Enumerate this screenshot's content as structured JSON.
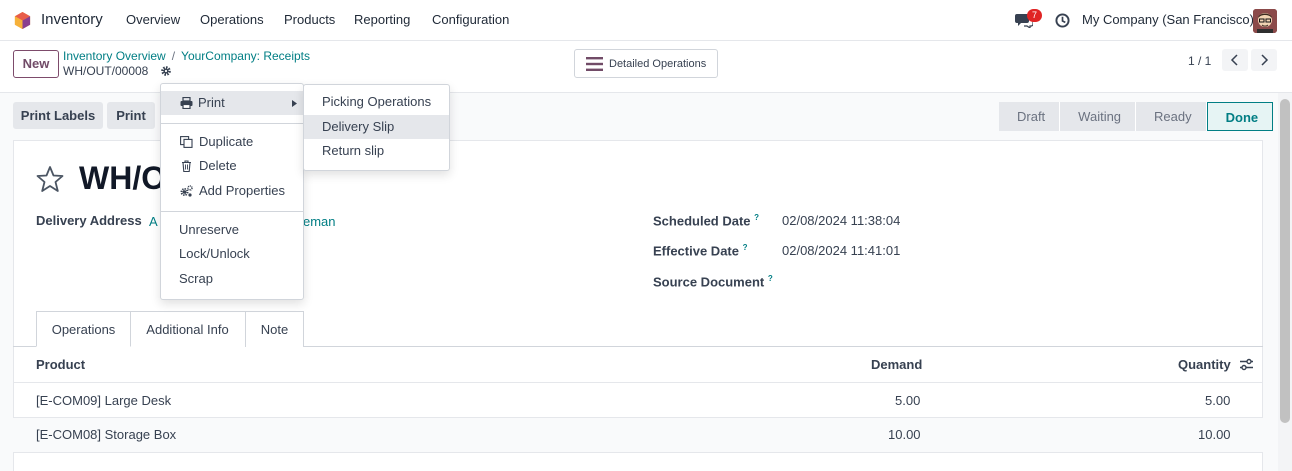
{
  "navbar": {
    "app_name": "Inventory",
    "menu": [
      "Overview",
      "Operations",
      "Products",
      "Reporting",
      "Configuration"
    ],
    "chat_badge": "7",
    "company": "My Company (San Francisco)"
  },
  "control_panel": {
    "new_label": "New",
    "breadcrumb": [
      "Inventory Overview",
      "YourCompany: Receipts"
    ],
    "record_name": "WH/OUT/00008",
    "detailed_ops_label": "Detailed Operations",
    "pager": "1 / 1"
  },
  "actions": {
    "print_labels": "Print Labels",
    "print": "Print"
  },
  "status_steps": [
    "Draft",
    "Waiting",
    "Ready",
    "Done"
  ],
  "status_active": "Done",
  "form": {
    "title": "WH/O",
    "delivery_address_label": "Delivery Address",
    "delivery_address_value_left": "A",
    "delivery_address_value_right": "eman",
    "scheduled_date_label": "Scheduled Date",
    "scheduled_date": "02/08/2024 11:38:04",
    "effective_date_label": "Effective Date",
    "effective_date": "02/08/2024 11:41:01",
    "source_document_label": "Source Document",
    "help_mark": "?"
  },
  "tabs": [
    "Operations",
    "Additional Info",
    "Note"
  ],
  "table": {
    "headers": {
      "product": "Product",
      "demand": "Demand",
      "quantity": "Quantity"
    },
    "rows": [
      {
        "product": "[E-COM09] Large Desk",
        "demand": "5.00",
        "quantity": "5.00"
      },
      {
        "product": "[E-COM08] Storage Box",
        "demand": "10.00",
        "quantity": "10.00"
      }
    ]
  },
  "dropdown": {
    "print": "Print",
    "duplicate": "Duplicate",
    "delete": "Delete",
    "add_properties": "Add Properties",
    "unreserve": "Unreserve",
    "lock_unlock": "Lock/Unlock",
    "scrap": "Scrap"
  },
  "submenu": [
    "Picking Operations",
    "Delivery Slip",
    "Return slip"
  ],
  "colors": {
    "brand": "#714b67",
    "accent": "#017e84",
    "badge": "#e02424"
  }
}
